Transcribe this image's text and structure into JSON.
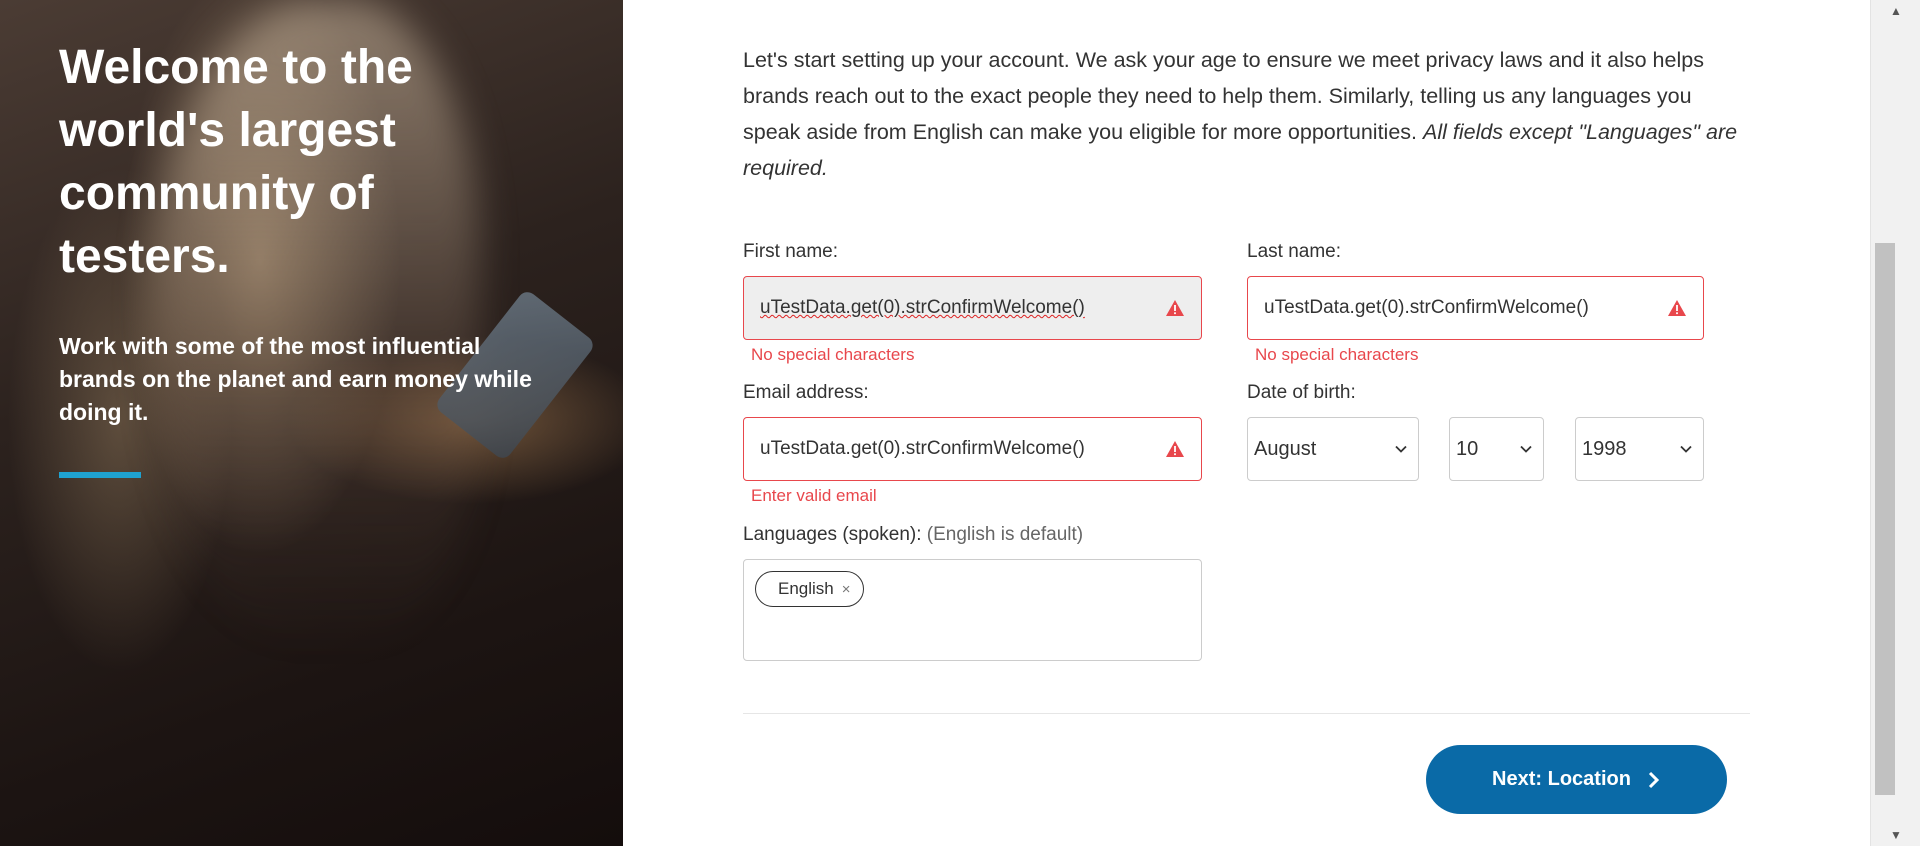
{
  "hero": {
    "title": "Welcome to the world's largest community of testers.",
    "subtitle": "Work with some of the most influential brands on the planet and earn money while doing it."
  },
  "intro": {
    "text": "Let's start setting up your account. We ask your age to ensure we meet privacy laws and it also helps brands reach out to the exact people they need to help them. Similarly, telling us any languages you speak aside from English can make you eligible for more opportunities. ",
    "required_note": "All fields except \"Languages\" are required."
  },
  "first_name": {
    "label": "First name:",
    "value": "uTestData.get(0).strConfirmWelcome()",
    "error": "No special characters"
  },
  "last_name": {
    "label": "Last name:",
    "value": "uTestData.get(0).strConfirmWelcome()",
    "error": "No special characters"
  },
  "email": {
    "label": "Email address:",
    "value": "uTestData.get(0).strConfirmWelcome()",
    "error": "Enter valid email"
  },
  "dob": {
    "label": "Date of birth:",
    "month": "August",
    "day": "10",
    "year": "1998"
  },
  "languages": {
    "label": "Languages (spoken):",
    "hint": "(English is default)",
    "chips": [
      "English"
    ],
    "remove_glyph": "×"
  },
  "next_button": {
    "label": "Next: Location"
  },
  "colors": {
    "error": "#e8474c",
    "primary": "#0a6aa7",
    "accent": "#1fa2d0"
  },
  "icons": {
    "warning": "warning-triangle-icon",
    "chevron": "chevron-down-icon",
    "arrow": "chevron-right-icon"
  }
}
